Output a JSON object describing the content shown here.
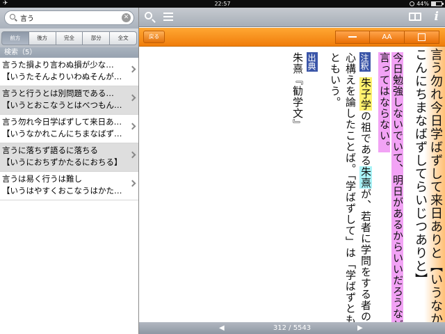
{
  "status": {
    "time": "22:57",
    "battery": "44%",
    "battery_level": 0.44
  },
  "search": {
    "value": "言う",
    "clear_label": "✕"
  },
  "segments": [
    {
      "label": "前方",
      "active": true
    },
    {
      "label": "後方",
      "active": false
    },
    {
      "label": "完全",
      "active": false
    },
    {
      "label": "部分",
      "active": false
    },
    {
      "label": "全文",
      "active": false
    }
  ],
  "results": {
    "count_label": "検索（5）",
    "items": [
      {
        "line1": "言うた損より言わぬ損が少な…",
        "line2": "【いうたそんよりいわぬそんが…"
      },
      {
        "line1": "言うと行うとは別問題である…",
        "line2": "【いうとおこなうとはべつもん…"
      },
      {
        "line1": "言う勿れ今日学ばずして来日あり…",
        "line2": "【いうなかれこんにちまなばず…"
      },
      {
        "line1": "言うに落ちず語るに落ちる",
        "line2": "【いうにおちずかたるにおちる】"
      },
      {
        "line1": "言うは易く行うは難し",
        "line2": "【いうはやすくおこなうはかたし】"
      }
    ]
  },
  "toolbar": {
    "back_label": "戻る",
    "font_label": "AA"
  },
  "entry": {
    "col1": "言う勿れ今日学ばずして来日ありと【いうなかれ",
    "col2": "こんにちまなばずしてらいじつありと】",
    "def1": "今日勉強しないでいて、明日があるからいいだろうなどと",
    "def2": "言ってはならない。",
    "note_tag": "注釈",
    "note1_a": "朱子学",
    "note1_b": "の祖である",
    "note1_c": "朱熹",
    "note1_d": "が、若者に学問をする者の",
    "note2": "心構えを論したことば。「学ばずして」は「学ばずとも」",
    "note3": "ともいう。",
    "source_tag": "出典",
    "source": "朱熹『勧学文』"
  },
  "pager": {
    "prev": "◀",
    "next": "▶",
    "current": "312",
    "total": "5543",
    "sep": "/"
  }
}
